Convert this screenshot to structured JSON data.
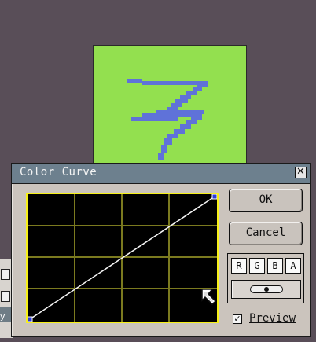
{
  "dialog": {
    "title": "Color Curve",
    "close_glyph": "✕",
    "ok_label": "OK",
    "cancel_label": "Cancel",
    "channels": [
      "R",
      "G",
      "B",
      "A"
    ],
    "preview_label": "Preview",
    "preview_checked": true,
    "preview_check_glyph": "✓"
  },
  "toolbar": {
    "partial_text": "y"
  },
  "colors": {
    "desktop": "#594e58",
    "artwork_bg": "#93e04f",
    "artwork_stroke": "#5f72d9",
    "titlebar": "#6d808e",
    "curve_frame": "#f7f01a",
    "curve_grid": "#7b7a1f",
    "curve_line": "#f5f5f5",
    "control_point": "#2c3bd6"
  }
}
